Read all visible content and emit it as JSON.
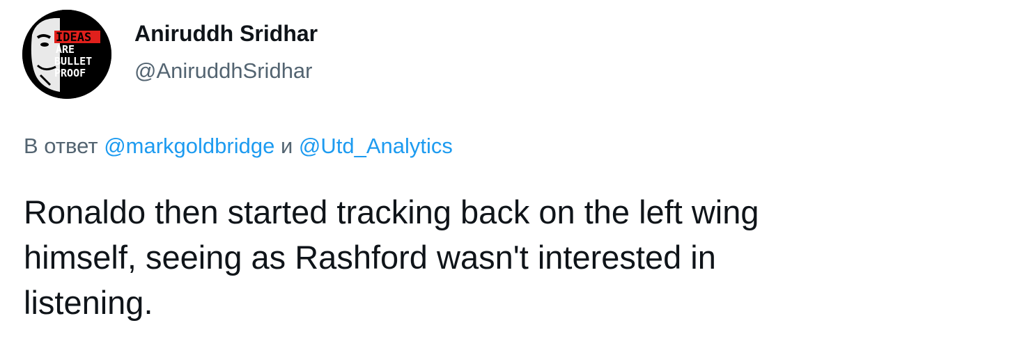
{
  "tweet": {
    "author": {
      "display_name": "Aniruddh Sridhar",
      "handle": "@AniruddhSridhar",
      "avatar_text": [
        "IDEAS",
        "ARE",
        "BULLET",
        "PROOF"
      ]
    },
    "reply_context": {
      "prefix": "В ответ ",
      "mention_1": "@markgoldbridge",
      "conjunction": " и ",
      "mention_2": "@Utd_Analytics"
    },
    "text": "Ronaldo then started tracking back on the left wing\nhimself, seeing as Rashford wasn't interested in\nlistening."
  },
  "colors": {
    "text_primary": "#0f1419",
    "text_secondary": "#536471",
    "link": "#1d9bf0",
    "avatar_accent": "#e0201c"
  }
}
